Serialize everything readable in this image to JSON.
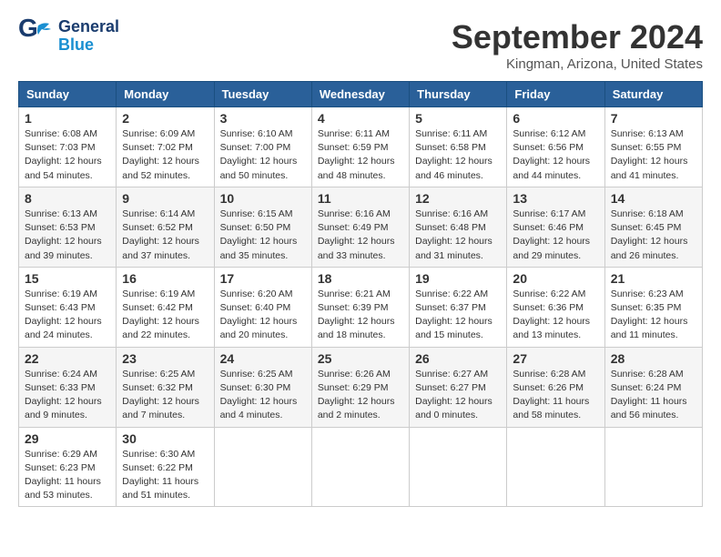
{
  "header": {
    "logo_general": "General",
    "logo_blue": "Blue",
    "month_title": "September 2024",
    "location": "Kingman, Arizona, United States"
  },
  "columns": [
    "Sunday",
    "Monday",
    "Tuesday",
    "Wednesday",
    "Thursday",
    "Friday",
    "Saturday"
  ],
  "weeks": [
    {
      "days": [
        {
          "number": "1",
          "sunrise": "6:08 AM",
          "sunset": "7:03 PM",
          "daylight": "12 hours and 54 minutes."
        },
        {
          "number": "2",
          "sunrise": "6:09 AM",
          "sunset": "7:02 PM",
          "daylight": "12 hours and 52 minutes."
        },
        {
          "number": "3",
          "sunrise": "6:10 AM",
          "sunset": "7:00 PM",
          "daylight": "12 hours and 50 minutes."
        },
        {
          "number": "4",
          "sunrise": "6:11 AM",
          "sunset": "6:59 PM",
          "daylight": "12 hours and 48 minutes."
        },
        {
          "number": "5",
          "sunrise": "6:11 AM",
          "sunset": "6:58 PM",
          "daylight": "12 hours and 46 minutes."
        },
        {
          "number": "6",
          "sunrise": "6:12 AM",
          "sunset": "6:56 PM",
          "daylight": "12 hours and 44 minutes."
        },
        {
          "number": "7",
          "sunrise": "6:13 AM",
          "sunset": "6:55 PM",
          "daylight": "12 hours and 41 minutes."
        }
      ]
    },
    {
      "days": [
        {
          "number": "8",
          "sunrise": "6:13 AM",
          "sunset": "6:53 PM",
          "daylight": "12 hours and 39 minutes."
        },
        {
          "number": "9",
          "sunrise": "6:14 AM",
          "sunset": "6:52 PM",
          "daylight": "12 hours and 37 minutes."
        },
        {
          "number": "10",
          "sunrise": "6:15 AM",
          "sunset": "6:50 PM",
          "daylight": "12 hours and 35 minutes."
        },
        {
          "number": "11",
          "sunrise": "6:16 AM",
          "sunset": "6:49 PM",
          "daylight": "12 hours and 33 minutes."
        },
        {
          "number": "12",
          "sunrise": "6:16 AM",
          "sunset": "6:48 PM",
          "daylight": "12 hours and 31 minutes."
        },
        {
          "number": "13",
          "sunrise": "6:17 AM",
          "sunset": "6:46 PM",
          "daylight": "12 hours and 29 minutes."
        },
        {
          "number": "14",
          "sunrise": "6:18 AM",
          "sunset": "6:45 PM",
          "daylight": "12 hours and 26 minutes."
        }
      ]
    },
    {
      "days": [
        {
          "number": "15",
          "sunrise": "6:19 AM",
          "sunset": "6:43 PM",
          "daylight": "12 hours and 24 minutes."
        },
        {
          "number": "16",
          "sunrise": "6:19 AM",
          "sunset": "6:42 PM",
          "daylight": "12 hours and 22 minutes."
        },
        {
          "number": "17",
          "sunrise": "6:20 AM",
          "sunset": "6:40 PM",
          "daylight": "12 hours and 20 minutes."
        },
        {
          "number": "18",
          "sunrise": "6:21 AM",
          "sunset": "6:39 PM",
          "daylight": "12 hours and 18 minutes."
        },
        {
          "number": "19",
          "sunrise": "6:22 AM",
          "sunset": "6:37 PM",
          "daylight": "12 hours and 15 minutes."
        },
        {
          "number": "20",
          "sunrise": "6:22 AM",
          "sunset": "6:36 PM",
          "daylight": "12 hours and 13 minutes."
        },
        {
          "number": "21",
          "sunrise": "6:23 AM",
          "sunset": "6:35 PM",
          "daylight": "12 hours and 11 minutes."
        }
      ]
    },
    {
      "days": [
        {
          "number": "22",
          "sunrise": "6:24 AM",
          "sunset": "6:33 PM",
          "daylight": "12 hours and 9 minutes."
        },
        {
          "number": "23",
          "sunrise": "6:25 AM",
          "sunset": "6:32 PM",
          "daylight": "12 hours and 7 minutes."
        },
        {
          "number": "24",
          "sunrise": "6:25 AM",
          "sunset": "6:30 PM",
          "daylight": "12 hours and 4 minutes."
        },
        {
          "number": "25",
          "sunrise": "6:26 AM",
          "sunset": "6:29 PM",
          "daylight": "12 hours and 2 minutes."
        },
        {
          "number": "26",
          "sunrise": "6:27 AM",
          "sunset": "6:27 PM",
          "daylight": "12 hours and 0 minutes."
        },
        {
          "number": "27",
          "sunrise": "6:28 AM",
          "sunset": "6:26 PM",
          "daylight": "11 hours and 58 minutes."
        },
        {
          "number": "28",
          "sunrise": "6:28 AM",
          "sunset": "6:24 PM",
          "daylight": "11 hours and 56 minutes."
        }
      ]
    },
    {
      "days": [
        {
          "number": "29",
          "sunrise": "6:29 AM",
          "sunset": "6:23 PM",
          "daylight": "11 hours and 53 minutes."
        },
        {
          "number": "30",
          "sunrise": "6:30 AM",
          "sunset": "6:22 PM",
          "daylight": "11 hours and 51 minutes."
        },
        null,
        null,
        null,
        null,
        null
      ]
    }
  ],
  "labels": {
    "sunrise": "Sunrise:",
    "sunset": "Sunset:",
    "daylight": "Daylight:"
  }
}
